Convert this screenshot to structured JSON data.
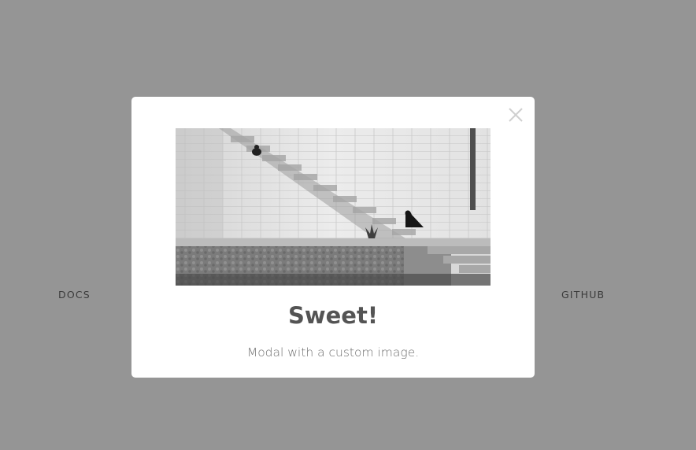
{
  "background": {
    "overlay_color": "#959595",
    "nav": {
      "docs_label": "DOCS",
      "github_label": "GITHUB"
    }
  },
  "modal": {
    "close_icon": "close-icon",
    "image_alt": "stone-stairs-photo",
    "title": "Sweet!",
    "text": "Modal with a custom image."
  }
}
